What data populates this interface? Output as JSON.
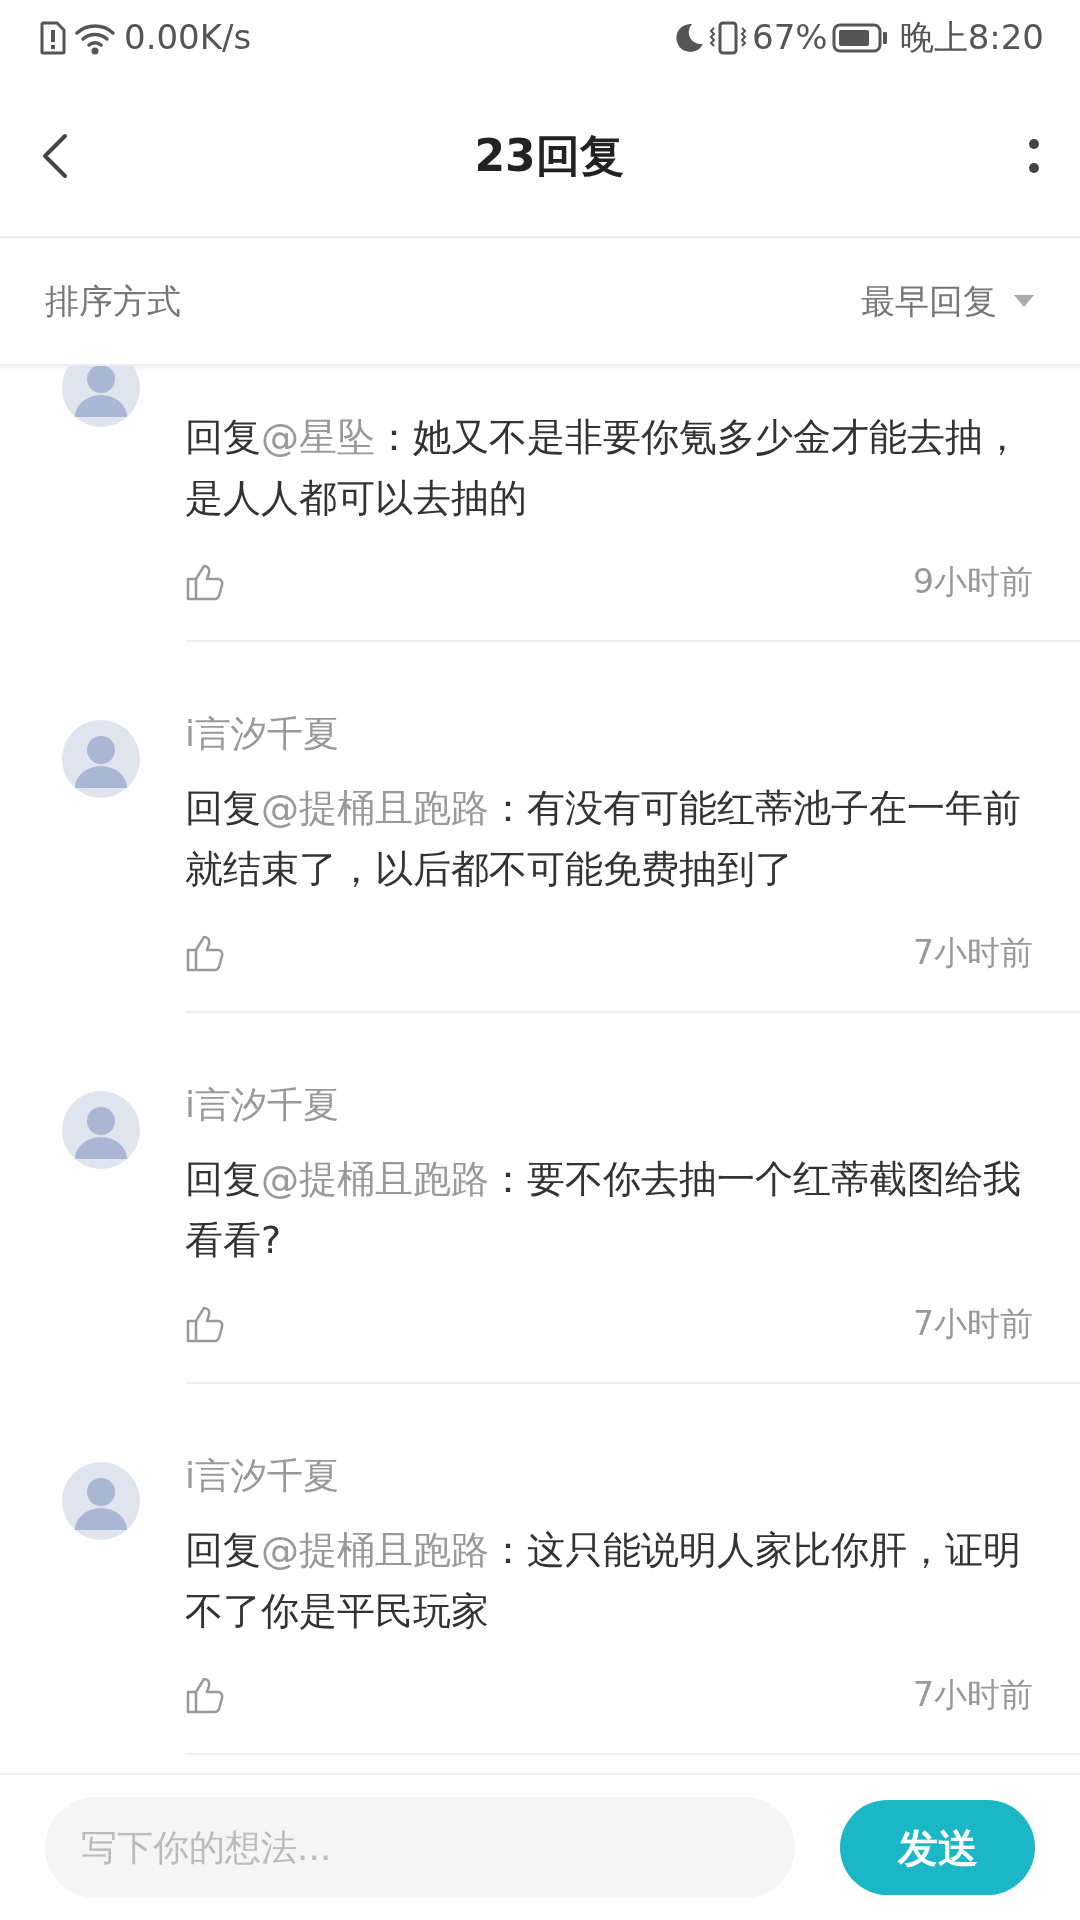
{
  "status_bar": {
    "speed": "0.00K/s",
    "battery_percent": "67%",
    "time": "晚上8:20"
  },
  "header": {
    "title": "23回复"
  },
  "sort": {
    "label": "排序方式",
    "value": "最早回复"
  },
  "comments": [
    {
      "prefix": "回复",
      "mention": "@星坠",
      "body": "：她又不是非要你氪多少金才能去抽，是人人都可以去抽的",
      "time": "9小时前"
    },
    {
      "author": "i言汐千夏",
      "prefix": "回复",
      "mention": "@提桶且跑路",
      "body": "：有没有可能红蒂池子在一年前就结束了，以后都不可能免费抽到了",
      "time": "7小时前"
    },
    {
      "author": "i言汐千夏",
      "prefix": "回复",
      "mention": "@提桶且跑路",
      "body": "：要不你去抽一个红蒂截图给我看看?",
      "time": "7小时前"
    },
    {
      "author": "i言汐千夏",
      "prefix": "回复",
      "mention": "@提桶且跑路",
      "body": "：这只能说明人家比你肝，证明不了你是平民玩家",
      "time": "7小时前"
    }
  ],
  "composer": {
    "placeholder": "写下你的想法...",
    "send": "发送"
  }
}
